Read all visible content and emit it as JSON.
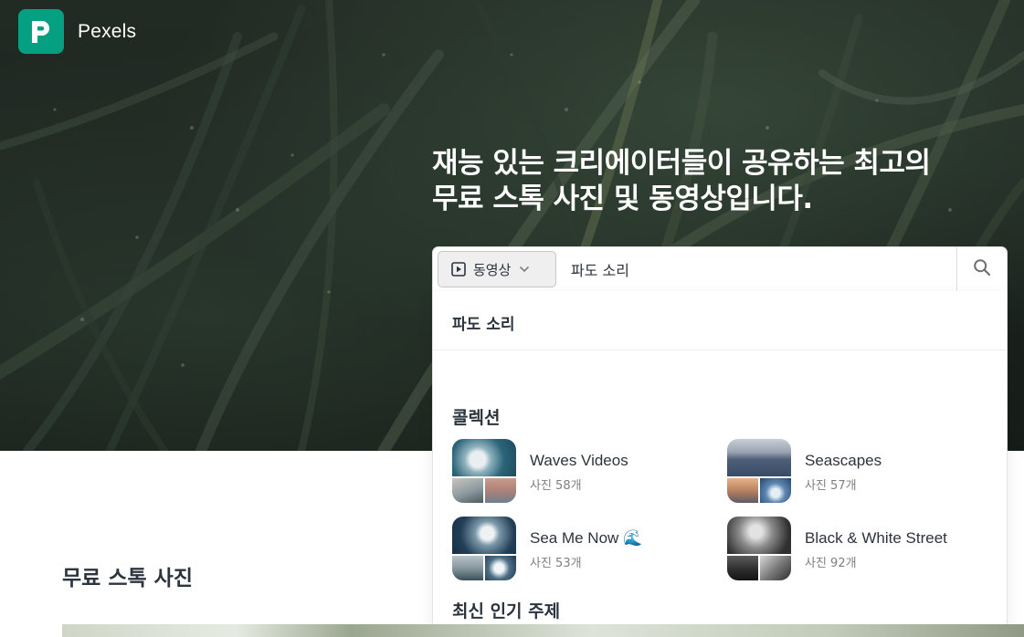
{
  "brand": {
    "name": "Pexels",
    "color": "#05a081"
  },
  "hero": {
    "headline_line1": "재능 있는 크리에이터들이 공유하는 최고의",
    "headline_line2": "무료 스톡 사진 및 동영상입니다."
  },
  "search": {
    "type_label": "동영상",
    "type_icon": "play-square-icon",
    "query": "파도 소리",
    "button_icon": "search-icon"
  },
  "dropdown": {
    "suggestion": "파도 소리",
    "collections_title": "콜렉션",
    "collections": [
      {
        "title": "Waves Videos",
        "count": "사진 58개"
      },
      {
        "title": "Seascapes",
        "count": "사진 57개"
      },
      {
        "title": "Sea Me Now 🌊",
        "count": "사진 53개"
      },
      {
        "title": "Black & White Street",
        "count": "사진 92개"
      }
    ],
    "trending_title": "최신 인기 주제"
  },
  "main": {
    "section_title": "무료 스톡 사진"
  }
}
